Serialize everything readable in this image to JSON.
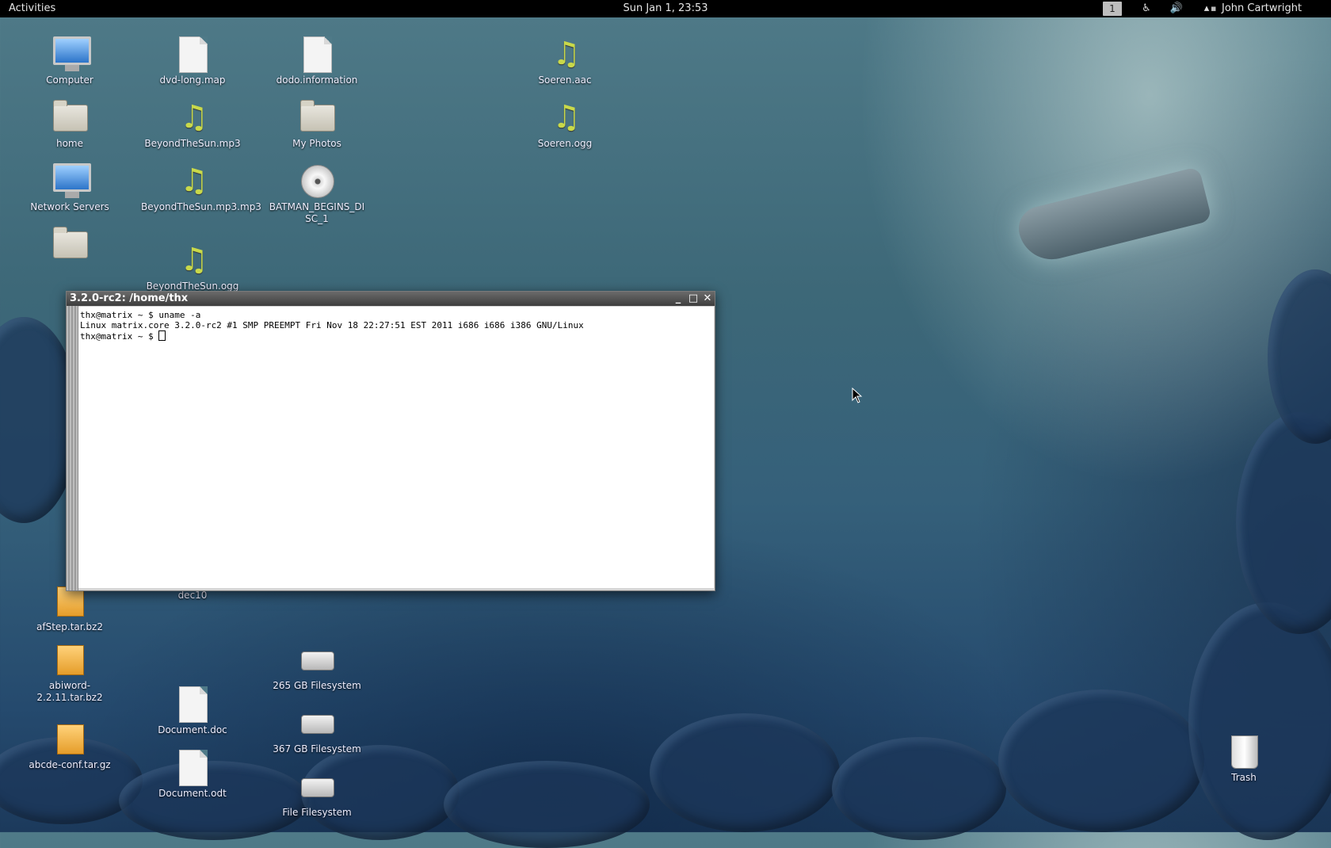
{
  "topbar": {
    "activities": "Activities",
    "clock": "Sun Jan 1, 23:53",
    "workspace": "1",
    "user": "John Cartwright"
  },
  "desktop": {
    "icons": [
      {
        "label": "Computer",
        "kind": "monitor-icon"
      },
      {
        "label": "dvd-long.map",
        "kind": "document-icon"
      },
      {
        "label": "dodo.information",
        "kind": "document-icon"
      },
      {
        "label": "Soeren.aac",
        "kind": "music-icon"
      },
      {
        "label": "home",
        "kind": "home-folder-icon"
      },
      {
        "label": "BeyondTheSun.mp3",
        "kind": "music-icon"
      },
      {
        "label": "My Photos",
        "kind": "folder-icon"
      },
      {
        "label": "Soeren.ogg",
        "kind": "music-icon"
      },
      {
        "label": "Network Servers",
        "kind": "network-icon"
      },
      {
        "label": "BeyondTheSun.mp3.mp3",
        "kind": "music-icon"
      },
      {
        "label": "BATMAN_BEGINS_DISC_1",
        "kind": "dvd-icon"
      },
      {
        "label": "BeyondTheSun.ogg",
        "kind": "music-icon"
      },
      {
        "label": "afStep.tar.bz2",
        "kind": "package-icon"
      },
      {
        "label": "dec10",
        "kind": "document-icon"
      },
      {
        "label": "abiword-2.2.11.tar.bz2",
        "kind": "package-icon"
      },
      {
        "label": "265 GB Filesystem",
        "kind": "drive-icon"
      },
      {
        "label": "Document.doc",
        "kind": "image-document-icon"
      },
      {
        "label": "367 GB Filesystem",
        "kind": "drive-icon"
      },
      {
        "label": "abcde-conf.tar.gz",
        "kind": "package-icon"
      },
      {
        "label": "Document.odt",
        "kind": "image-document-icon"
      },
      {
        "label": "File Filesystem",
        "kind": "drive-icon"
      },
      {
        "label": "Trash",
        "kind": "trash-icon"
      }
    ]
  },
  "terminal": {
    "title": "3.2.0-rc2: /home/thx",
    "lines": [
      "thx@matrix ~ $ uname -a",
      "Linux matrix.core 3.2.0-rc2 #1 SMP PREEMPT Fri Nov 18 22:27:51 EST 2011 i686 i686 i386 GNU/Linux",
      "thx@matrix ~ $ "
    ],
    "buttons": {
      "minimize": "_",
      "maximize": "□",
      "close": "✕"
    }
  }
}
